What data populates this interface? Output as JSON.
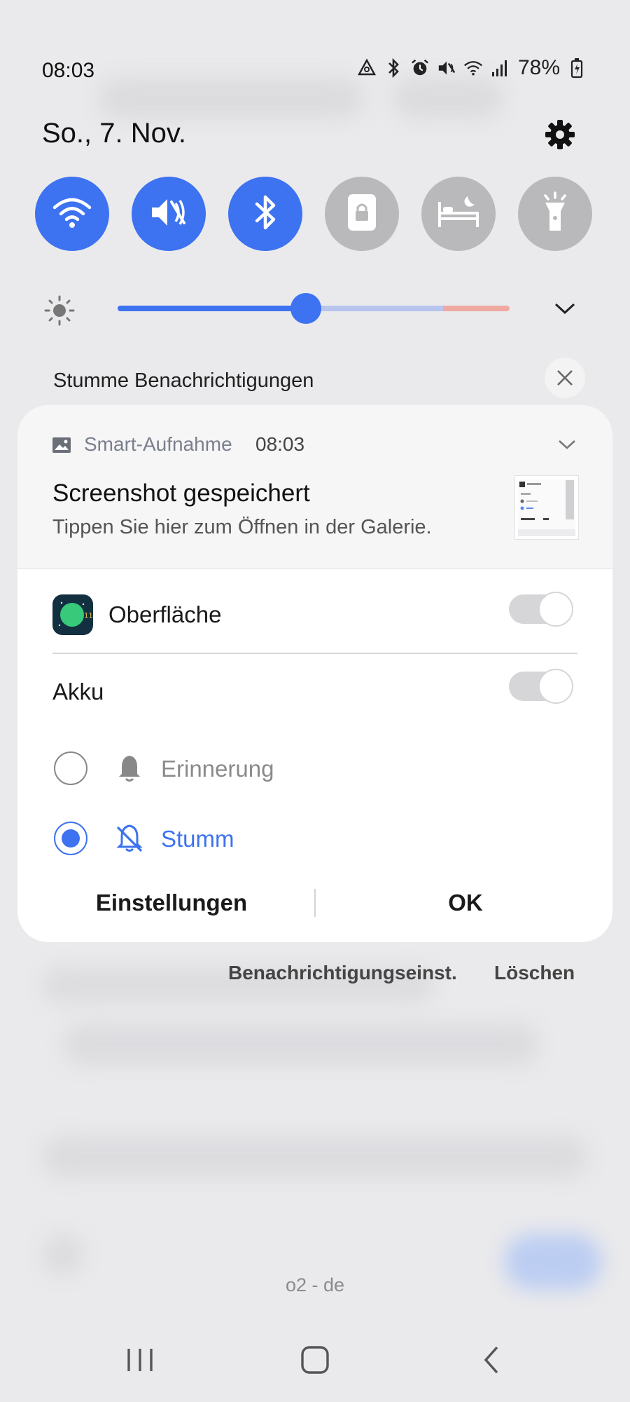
{
  "status_bar": {
    "time": "08:03",
    "battery": "78%",
    "icons": [
      "data-saver-icon",
      "bluetooth-icon",
      "alarm-icon",
      "mute-icon",
      "wifi-icon",
      "signal-icon",
      "battery-charging-icon"
    ]
  },
  "header": {
    "date": "So., 7. Nov.",
    "settings_icon": "gear-icon"
  },
  "quick_settings": [
    {
      "name": "wifi",
      "icon": "wifi-icon",
      "active": true
    },
    {
      "name": "sound",
      "icon": "mute-icon",
      "active": true
    },
    {
      "name": "bluetooth",
      "icon": "bluetooth-icon",
      "active": true
    },
    {
      "name": "rotation-lock",
      "icon": "lock-screen-icon",
      "active": false
    },
    {
      "name": "sleep-mode",
      "icon": "bed-icon",
      "active": false
    },
    {
      "name": "flashlight",
      "icon": "flashlight-icon",
      "active": false
    }
  ],
  "brightness": {
    "level": 0.48,
    "icon": "sun-icon"
  },
  "silent_notifications": {
    "title": "Stumme Benachrichtigungen"
  },
  "notification": {
    "app_name": "Smart-Aufnahme",
    "time": "08:03",
    "title": "Screenshot gespeichert",
    "body": "Tippen Sie hier zum Öffnen in der Galerie."
  },
  "channels": {
    "app_label": "Oberfläche",
    "app_toggle_on": false,
    "akku_label": "Akku",
    "akku_toggle_on": false,
    "options": [
      {
        "label": "Erinnerung",
        "selected": false,
        "icon": "bell-icon"
      },
      {
        "label": "Stumm",
        "selected": true,
        "icon": "bell-off-icon"
      }
    ]
  },
  "buttons": {
    "settings": "Einstellungen",
    "ok": "OK"
  },
  "footer": {
    "notification_settings": "Benachrichtigungseinst.",
    "clear": "Löschen"
  },
  "carrier": "o2 - de",
  "colors": {
    "accent": "#3d72f0",
    "inactive": "#b9b9bb"
  }
}
